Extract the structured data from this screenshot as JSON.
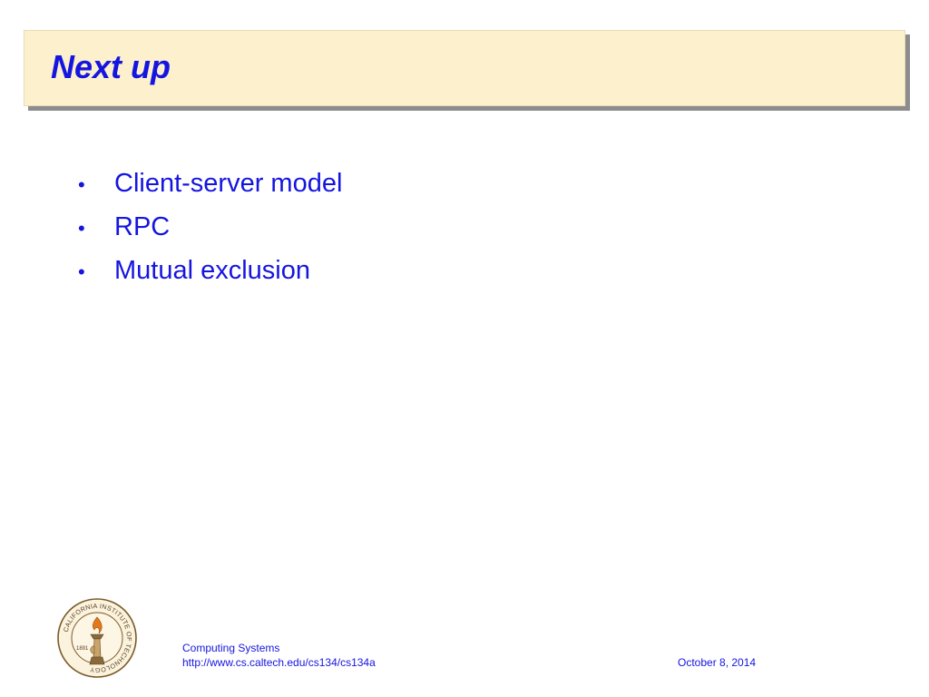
{
  "slide": {
    "title": "Next up",
    "bullets": [
      "Client-server model",
      "RPC",
      "Mutual exclusion"
    ],
    "bullet_glyph": "•"
  },
  "footer": {
    "course": "Computing Systems",
    "url": "http://www.cs.caltech.edu/cs134/cs134a",
    "date": "October 8, 2014"
  },
  "seal": {
    "icon": "caltech-seal-icon",
    "ring_text": "CALIFORNIA INSTITUTE OF TECHNOLOGY",
    "year": "1891"
  },
  "colors": {
    "accent": "#1515e0",
    "title_background": "#fdf0cd",
    "title_shadow": "#8c8c8c",
    "seal_ink": "#7a5a2a"
  }
}
